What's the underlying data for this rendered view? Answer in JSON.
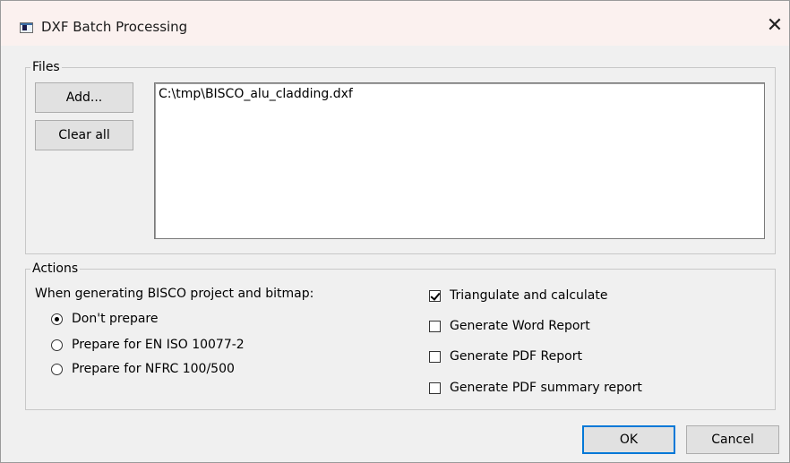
{
  "window": {
    "title": "DXF Batch Processing",
    "close_glyph": "✕"
  },
  "files": {
    "legend": "Files",
    "add_label": "Add...",
    "clear_label": "Clear all",
    "items": [
      "C:\\tmp\\BISCO_alu_cladding.dxf"
    ]
  },
  "actions": {
    "legend": "Actions",
    "prompt": "When generating BISCO project and bitmap:",
    "radios": [
      {
        "label": "Don't prepare",
        "checked": true
      },
      {
        "label": "Prepare for EN ISO 10077-2",
        "checked": false
      },
      {
        "label": "Prepare for NFRC 100/500",
        "checked": false
      }
    ],
    "checks": [
      {
        "label": "Triangulate and calculate",
        "checked": true
      },
      {
        "label": "Generate Word Report",
        "checked": false
      },
      {
        "label": "Generate PDF Report",
        "checked": false
      },
      {
        "label": "Generate PDF summary report",
        "checked": false
      }
    ]
  },
  "footer": {
    "ok_label": "OK",
    "cancel_label": "Cancel"
  },
  "colors": {
    "titlebar": "#fbf1ef",
    "dialog_bg": "#f0f0f0",
    "default_button_border": "#0078d7"
  }
}
